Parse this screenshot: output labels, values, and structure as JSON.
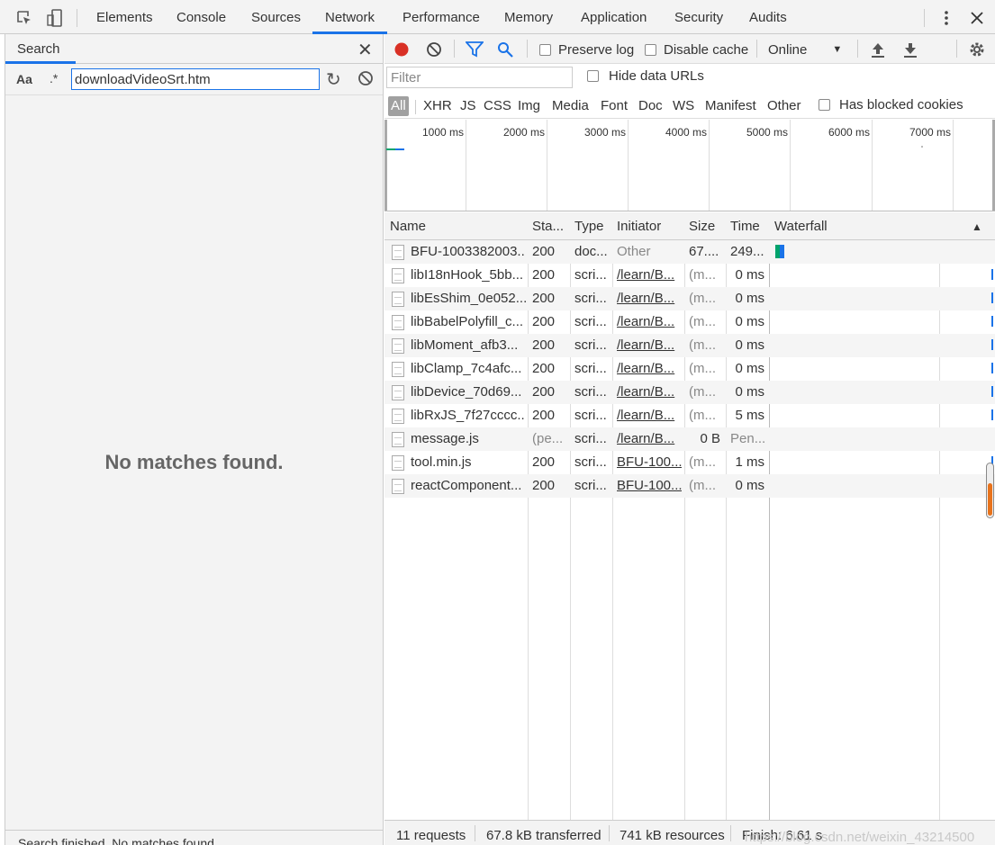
{
  "devtools": {
    "tabs": [
      "Elements",
      "Console",
      "Sources",
      "Network",
      "Performance",
      "Memory",
      "Application",
      "Security",
      "Audits"
    ],
    "active_tab": "Network"
  },
  "search": {
    "title": "Search",
    "case_toggle": "Aa",
    "regex_toggle": ".*",
    "query": "downloadVideoSrt.htm",
    "empty_message": "No matches found.",
    "status": "Search finished.  No matches found."
  },
  "network": {
    "preserve_log": "Preserve log",
    "disable_cache": "Disable cache",
    "throttling": "Online",
    "filter_placeholder": "Filter",
    "hide_data_urls": "Hide data URLs",
    "type_filters": [
      "All",
      "XHR",
      "JS",
      "CSS",
      "Img",
      "Media",
      "Font",
      "Doc",
      "WS",
      "Manifest",
      "Other"
    ],
    "has_blocked_cookies": "Has blocked cookies",
    "overview_ticks": [
      "1000 ms",
      "2000 ms",
      "3000 ms",
      "4000 ms",
      "5000 ms",
      "6000 ms",
      "7000 ms"
    ],
    "columns": [
      "Name",
      "Sta...",
      "Type",
      "Initiator",
      "Size",
      "Time",
      "Waterfall"
    ],
    "rows": [
      {
        "name": "BFU-1003382003...",
        "status": "200",
        "type": "doc...",
        "initiator": "Other",
        "size": "67....",
        "time": "249..."
      },
      {
        "name": "libI18nHook_5bb...",
        "status": "200",
        "type": "scri...",
        "initiator": "/learn/B...",
        "size": "(m...",
        "time": "0 ms"
      },
      {
        "name": "libEsShim_0e052...",
        "status": "200",
        "type": "scri...",
        "initiator": "/learn/B...",
        "size": "(m...",
        "time": "0 ms"
      },
      {
        "name": "libBabelPolyfill_c...",
        "status": "200",
        "type": "scri...",
        "initiator": "/learn/B...",
        "size": "(m...",
        "time": "0 ms"
      },
      {
        "name": "libMoment_afb3...",
        "status": "200",
        "type": "scri...",
        "initiator": "/learn/B...",
        "size": "(m...",
        "time": "0 ms"
      },
      {
        "name": "libClamp_7c4afc...",
        "status": "200",
        "type": "scri...",
        "initiator": "/learn/B...",
        "size": "(m...",
        "time": "0 ms"
      },
      {
        "name": "libDevice_70d69...",
        "status": "200",
        "type": "scri...",
        "initiator": "/learn/B...",
        "size": "(m...",
        "time": "0 ms"
      },
      {
        "name": "libRxJS_7f27cccc...",
        "status": "200",
        "type": "scri...",
        "initiator": "/learn/B...",
        "size": "(m...",
        "time": "5 ms"
      },
      {
        "name": "message.js",
        "status": "(pe...",
        "type": "scri...",
        "initiator": "/learn/B...",
        "size": "0 B",
        "time": "Pen..."
      },
      {
        "name": "tool.min.js",
        "status": "200",
        "type": "scri...",
        "initiator": "BFU-100...",
        "size": "(m...",
        "time": "1 ms"
      },
      {
        "name": "reactComponent...",
        "status": "200",
        "type": "scri...",
        "initiator": "BFU-100...",
        "size": "(m...",
        "time": "0 ms"
      }
    ],
    "summary": {
      "requests": "11 requests",
      "transferred": "67.8 kB transferred",
      "resources": "741 kB resources",
      "finish": "Finish: 6.61 s"
    },
    "watermark": "https://blog.csdn.net/weixin_43214500"
  },
  "colors": {
    "record": "#d93025",
    "accent": "#1a73e8",
    "waterfall_wait": "#00a36c",
    "waterfall_download": "#1a73e8"
  }
}
